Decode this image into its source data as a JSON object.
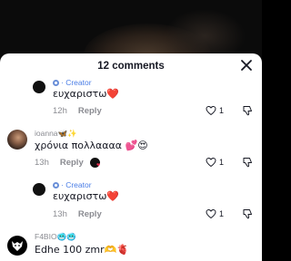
{
  "sheet": {
    "title": "12 comments",
    "close_icon": "close-icon"
  },
  "comments": [
    {
      "author": "",
      "creator_label": "· Creator",
      "text": "ευχαριστω❤️",
      "time": "12h",
      "reply": "Reply",
      "likes": "1"
    },
    {
      "author": "ioanna🦋✨",
      "text": "χρόνια πολλαααα 💕😍",
      "time": "13h",
      "reply": "Reply",
      "likes": "1"
    },
    {
      "author": "",
      "creator_label": "· Creator",
      "text": "ευχαριστω❤️",
      "time": "13h",
      "reply": "Reply",
      "likes": "1"
    },
    {
      "author": "F4BIO🥶🥶",
      "text": "Edhe 100 zmr🫶🫀"
    }
  ],
  "colors": {
    "creator": "#4a7de6",
    "like_heart": "#e8264b"
  }
}
